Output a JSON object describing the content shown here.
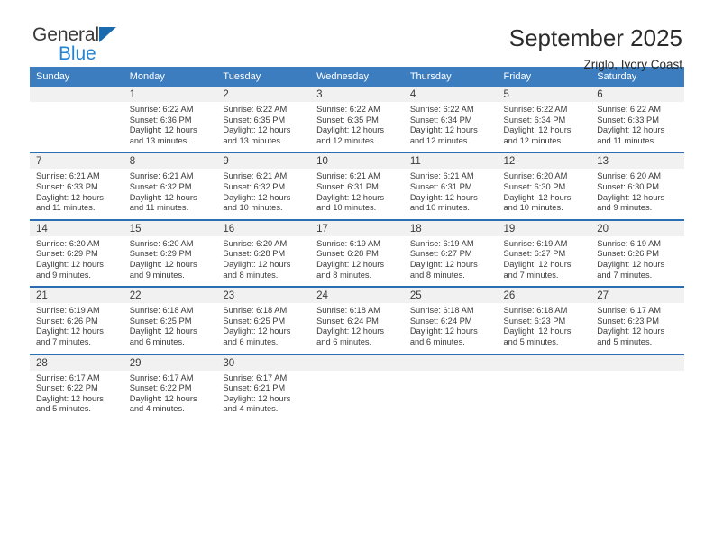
{
  "brand": {
    "name_top": "General",
    "name_bottom": "Blue",
    "triangle_color": "#1a6bb0",
    "blue_color": "#2585d3"
  },
  "header": {
    "title": "September 2025",
    "location": "Zriglo, Ivory Coast"
  },
  "calendar": {
    "header_bg": "#3b7dbf",
    "daynum_bg": "#f1f1f1",
    "separator_color": "#2a6db3",
    "weekdays": [
      "Sunday",
      "Monday",
      "Tuesday",
      "Wednesday",
      "Thursday",
      "Friday",
      "Saturday"
    ],
    "weeks": [
      [
        null,
        {
          "day": "1",
          "sunrise": "Sunrise: 6:22 AM",
          "sunset": "Sunset: 6:36 PM",
          "daylight_1": "Daylight: 12 hours",
          "daylight_2": "and 13 minutes."
        },
        {
          "day": "2",
          "sunrise": "Sunrise: 6:22 AM",
          "sunset": "Sunset: 6:35 PM",
          "daylight_1": "Daylight: 12 hours",
          "daylight_2": "and 13 minutes."
        },
        {
          "day": "3",
          "sunrise": "Sunrise: 6:22 AM",
          "sunset": "Sunset: 6:35 PM",
          "daylight_1": "Daylight: 12 hours",
          "daylight_2": "and 12 minutes."
        },
        {
          "day": "4",
          "sunrise": "Sunrise: 6:22 AM",
          "sunset": "Sunset: 6:34 PM",
          "daylight_1": "Daylight: 12 hours",
          "daylight_2": "and 12 minutes."
        },
        {
          "day": "5",
          "sunrise": "Sunrise: 6:22 AM",
          "sunset": "Sunset: 6:34 PM",
          "daylight_1": "Daylight: 12 hours",
          "daylight_2": "and 12 minutes."
        },
        {
          "day": "6",
          "sunrise": "Sunrise: 6:22 AM",
          "sunset": "Sunset: 6:33 PM",
          "daylight_1": "Daylight: 12 hours",
          "daylight_2": "and 11 minutes."
        }
      ],
      [
        {
          "day": "7",
          "sunrise": "Sunrise: 6:21 AM",
          "sunset": "Sunset: 6:33 PM",
          "daylight_1": "Daylight: 12 hours",
          "daylight_2": "and 11 minutes."
        },
        {
          "day": "8",
          "sunrise": "Sunrise: 6:21 AM",
          "sunset": "Sunset: 6:32 PM",
          "daylight_1": "Daylight: 12 hours",
          "daylight_2": "and 11 minutes."
        },
        {
          "day": "9",
          "sunrise": "Sunrise: 6:21 AM",
          "sunset": "Sunset: 6:32 PM",
          "daylight_1": "Daylight: 12 hours",
          "daylight_2": "and 10 minutes."
        },
        {
          "day": "10",
          "sunrise": "Sunrise: 6:21 AM",
          "sunset": "Sunset: 6:31 PM",
          "daylight_1": "Daylight: 12 hours",
          "daylight_2": "and 10 minutes."
        },
        {
          "day": "11",
          "sunrise": "Sunrise: 6:21 AM",
          "sunset": "Sunset: 6:31 PM",
          "daylight_1": "Daylight: 12 hours",
          "daylight_2": "and 10 minutes."
        },
        {
          "day": "12",
          "sunrise": "Sunrise: 6:20 AM",
          "sunset": "Sunset: 6:30 PM",
          "daylight_1": "Daylight: 12 hours",
          "daylight_2": "and 10 minutes."
        },
        {
          "day": "13",
          "sunrise": "Sunrise: 6:20 AM",
          "sunset": "Sunset: 6:30 PM",
          "daylight_1": "Daylight: 12 hours",
          "daylight_2": "and 9 minutes."
        }
      ],
      [
        {
          "day": "14",
          "sunrise": "Sunrise: 6:20 AM",
          "sunset": "Sunset: 6:29 PM",
          "daylight_1": "Daylight: 12 hours",
          "daylight_2": "and 9 minutes."
        },
        {
          "day": "15",
          "sunrise": "Sunrise: 6:20 AM",
          "sunset": "Sunset: 6:29 PM",
          "daylight_1": "Daylight: 12 hours",
          "daylight_2": "and 9 minutes."
        },
        {
          "day": "16",
          "sunrise": "Sunrise: 6:20 AM",
          "sunset": "Sunset: 6:28 PM",
          "daylight_1": "Daylight: 12 hours",
          "daylight_2": "and 8 minutes."
        },
        {
          "day": "17",
          "sunrise": "Sunrise: 6:19 AM",
          "sunset": "Sunset: 6:28 PM",
          "daylight_1": "Daylight: 12 hours",
          "daylight_2": "and 8 minutes."
        },
        {
          "day": "18",
          "sunrise": "Sunrise: 6:19 AM",
          "sunset": "Sunset: 6:27 PM",
          "daylight_1": "Daylight: 12 hours",
          "daylight_2": "and 8 minutes."
        },
        {
          "day": "19",
          "sunrise": "Sunrise: 6:19 AM",
          "sunset": "Sunset: 6:27 PM",
          "daylight_1": "Daylight: 12 hours",
          "daylight_2": "and 7 minutes."
        },
        {
          "day": "20",
          "sunrise": "Sunrise: 6:19 AM",
          "sunset": "Sunset: 6:26 PM",
          "daylight_1": "Daylight: 12 hours",
          "daylight_2": "and 7 minutes."
        }
      ],
      [
        {
          "day": "21",
          "sunrise": "Sunrise: 6:19 AM",
          "sunset": "Sunset: 6:26 PM",
          "daylight_1": "Daylight: 12 hours",
          "daylight_2": "and 7 minutes."
        },
        {
          "day": "22",
          "sunrise": "Sunrise: 6:18 AM",
          "sunset": "Sunset: 6:25 PM",
          "daylight_1": "Daylight: 12 hours",
          "daylight_2": "and 6 minutes."
        },
        {
          "day": "23",
          "sunrise": "Sunrise: 6:18 AM",
          "sunset": "Sunset: 6:25 PM",
          "daylight_1": "Daylight: 12 hours",
          "daylight_2": "and 6 minutes."
        },
        {
          "day": "24",
          "sunrise": "Sunrise: 6:18 AM",
          "sunset": "Sunset: 6:24 PM",
          "daylight_1": "Daylight: 12 hours",
          "daylight_2": "and 6 minutes."
        },
        {
          "day": "25",
          "sunrise": "Sunrise: 6:18 AM",
          "sunset": "Sunset: 6:24 PM",
          "daylight_1": "Daylight: 12 hours",
          "daylight_2": "and 6 minutes."
        },
        {
          "day": "26",
          "sunrise": "Sunrise: 6:18 AM",
          "sunset": "Sunset: 6:23 PM",
          "daylight_1": "Daylight: 12 hours",
          "daylight_2": "and 5 minutes."
        },
        {
          "day": "27",
          "sunrise": "Sunrise: 6:17 AM",
          "sunset": "Sunset: 6:23 PM",
          "daylight_1": "Daylight: 12 hours",
          "daylight_2": "and 5 minutes."
        }
      ],
      [
        {
          "day": "28",
          "sunrise": "Sunrise: 6:17 AM",
          "sunset": "Sunset: 6:22 PM",
          "daylight_1": "Daylight: 12 hours",
          "daylight_2": "and 5 minutes."
        },
        {
          "day": "29",
          "sunrise": "Sunrise: 6:17 AM",
          "sunset": "Sunset: 6:22 PM",
          "daylight_1": "Daylight: 12 hours",
          "daylight_2": "and 4 minutes."
        },
        {
          "day": "30",
          "sunrise": "Sunrise: 6:17 AM",
          "sunset": "Sunset: 6:21 PM",
          "daylight_1": "Daylight: 12 hours",
          "daylight_2": "and 4 minutes."
        },
        null,
        null,
        null,
        null
      ]
    ]
  }
}
